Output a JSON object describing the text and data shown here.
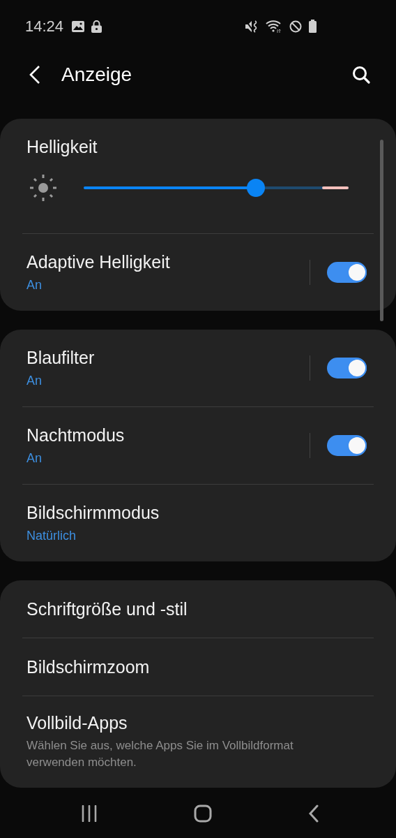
{
  "status_bar": {
    "time": "14:24"
  },
  "header": {
    "title": "Anzeige"
  },
  "cards": [
    {
      "items": [
        {
          "kind": "slider",
          "title": "Helligkeit",
          "level": 0.65
        },
        {
          "kind": "switch",
          "title": "Adaptive Helligkeit",
          "status": "An",
          "on": true
        }
      ]
    },
    {
      "items": [
        {
          "kind": "switch",
          "title": "Blaufilter",
          "status": "An",
          "on": true
        },
        {
          "kind": "switch",
          "title": "Nachtmodus",
          "status": "An",
          "on": true
        },
        {
          "kind": "link",
          "title": "Bildschirmmodus",
          "value": "Natürlich"
        }
      ]
    },
    {
      "items": [
        {
          "kind": "link",
          "title": "Schriftgröße und -stil"
        },
        {
          "kind": "link",
          "title": "Bildschirmzoom"
        },
        {
          "kind": "link",
          "title": "Vollbild-Apps",
          "description": "Wählen Sie aus, welche Apps Sie im Vollbildformat verwenden möchten."
        }
      ]
    }
  ]
}
